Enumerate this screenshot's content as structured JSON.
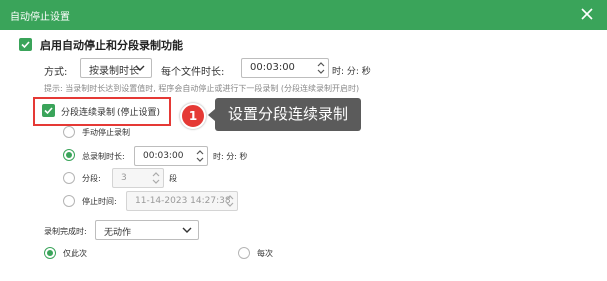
{
  "window": {
    "title": "自动停止设置"
  },
  "enable": {
    "label": "启用自动停止和分段录制功能",
    "checked": true
  },
  "mode": {
    "label": "方式:",
    "select_value": "按录制时长",
    "per_file_label": "每个文件时长:",
    "per_file_value": "00:03:00",
    "unit": "时: 分: 秒"
  },
  "hint": "提示: 当录制时长达到设置值时, 程序会自动停止或进行下一段录制 (分段连续录制开启时)",
  "segment": {
    "label": "分段连续录制",
    "stop_label": "(停止设置)",
    "checked": true
  },
  "callout": {
    "number": "1",
    "text": "设置分段连续录制"
  },
  "options": {
    "manual": {
      "label": "手动停止录制",
      "selected": false
    },
    "total": {
      "label": "总录制时长:",
      "value": "00:03:00",
      "unit": "时: 分: 秒",
      "selected": true
    },
    "segments": {
      "label": "分段:",
      "value": "3",
      "unit": "段",
      "selected": false
    },
    "stop_time": {
      "label": "停止时间:",
      "value": "11-14-2023 14:27:38",
      "selected": false
    }
  },
  "after": {
    "label": "录制完成时:",
    "select_value": "无动作",
    "only_once": {
      "label": "仅此次",
      "selected": true
    },
    "every_time": {
      "label": "每次",
      "selected": false
    }
  },
  "colors": {
    "accent": "#3aa45a",
    "callout": "#e53935",
    "tooltip": "#5b5b5b"
  }
}
